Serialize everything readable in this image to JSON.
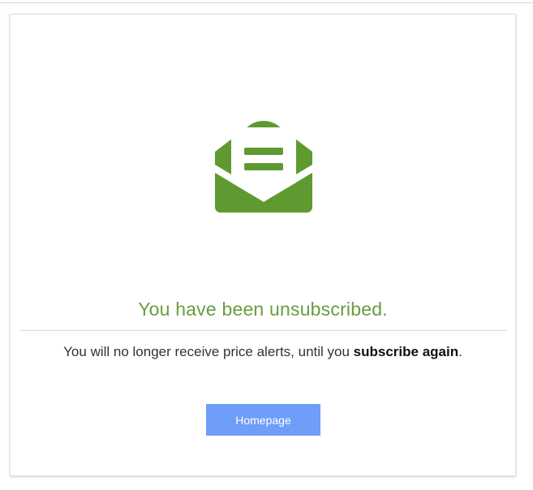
{
  "confirmation": {
    "icon": "open-envelope-icon",
    "title": "You have been unsubscribed.",
    "message_prefix": "You will no longer receive price alerts, until you ",
    "message_link": "subscribe again",
    "message_suffix": ".",
    "homepage_button_label": "Homepage"
  },
  "colors": {
    "icon_green": "#5f9a31",
    "title_green": "#6a9c3f",
    "button_blue": "#6f9df8"
  }
}
